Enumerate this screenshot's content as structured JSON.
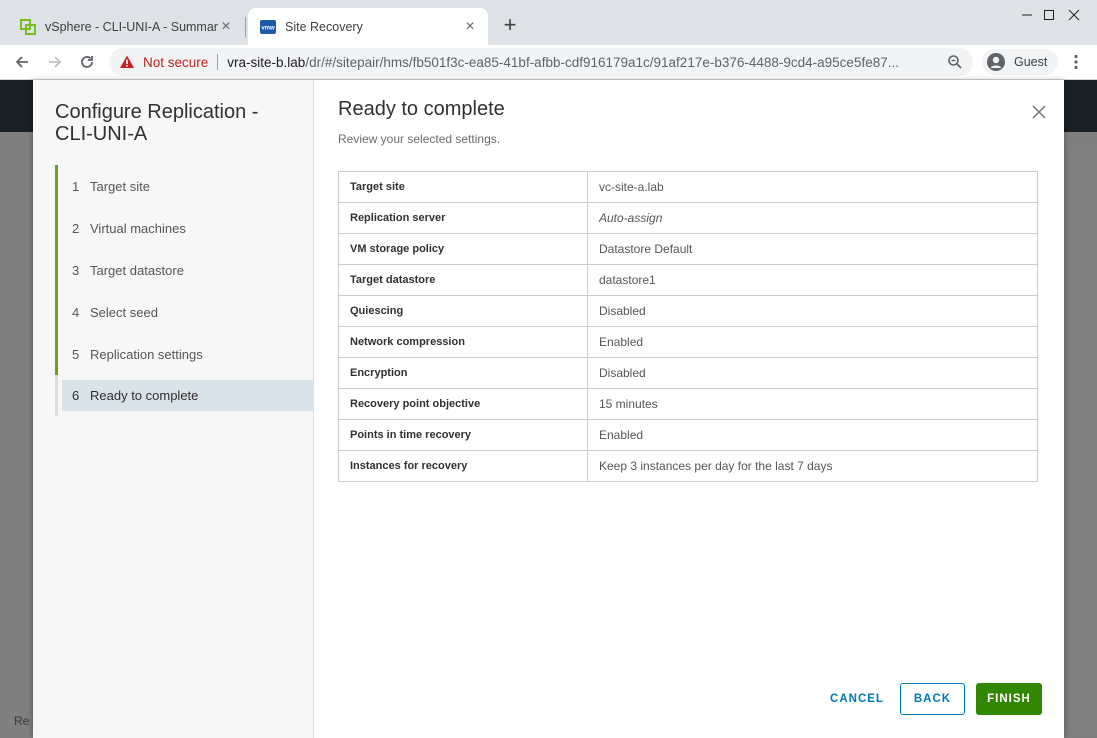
{
  "browser": {
    "tabs": [
      {
        "title": "vSphere - CLI-UNI-A - Summary",
        "icon": "vsphere-icon"
      },
      {
        "title": "Site Recovery",
        "icon": "vmw-icon",
        "favicon_text": "vmw"
      }
    ],
    "security_label": "Not secure",
    "url_host": "vra-site-b.lab",
    "url_path": "/dr/#/sitepair/hms/fb501f3c-ea85-41bf-afbb-cdf916179a1c/91af217e-b376-4488-9cd4-a95ce5fe87...",
    "profile_label": "Guest",
    "accent": "#1a73e8",
    "warning_color": "#c5221f"
  },
  "background": {
    "footer_text": "Re"
  },
  "wizard": {
    "title": "Configure Replication - CLI-UNI-A",
    "steps": [
      {
        "num": "1",
        "label": "Target site"
      },
      {
        "num": "2",
        "label": "Virtual machines"
      },
      {
        "num": "3",
        "label": "Target datastore"
      },
      {
        "num": "4",
        "label": "Select seed"
      },
      {
        "num": "5",
        "label": "Replication settings"
      },
      {
        "num": "6",
        "label": "Ready to complete"
      }
    ],
    "completed_color": "#62a420"
  },
  "main": {
    "title": "Ready to complete",
    "subtitle": "Review your selected settings.",
    "rows": [
      {
        "key": "Target site",
        "value": "vc-site-a.lab"
      },
      {
        "key": "Replication server",
        "value": "Auto-assign"
      },
      {
        "key": "VM storage policy",
        "value": "Datastore Default"
      },
      {
        "key": "Target datastore",
        "value": "datastore1"
      },
      {
        "key": "Quiescing",
        "value": "Disabled"
      },
      {
        "key": "Network compression",
        "value": "Enabled"
      },
      {
        "key": "Encryption",
        "value": "Disabled"
      },
      {
        "key": "Recovery point objective",
        "value": "15 minutes"
      },
      {
        "key": "Points in time recovery",
        "value": "Enabled"
      },
      {
        "key": "Instances for recovery",
        "value": "Keep 3 instances per day for the last 7 days"
      }
    ]
  },
  "footer": {
    "cancel_label": "CANCEL",
    "back_label": "BACK",
    "finish_label": "FINISH",
    "finish_color": "#318700"
  }
}
